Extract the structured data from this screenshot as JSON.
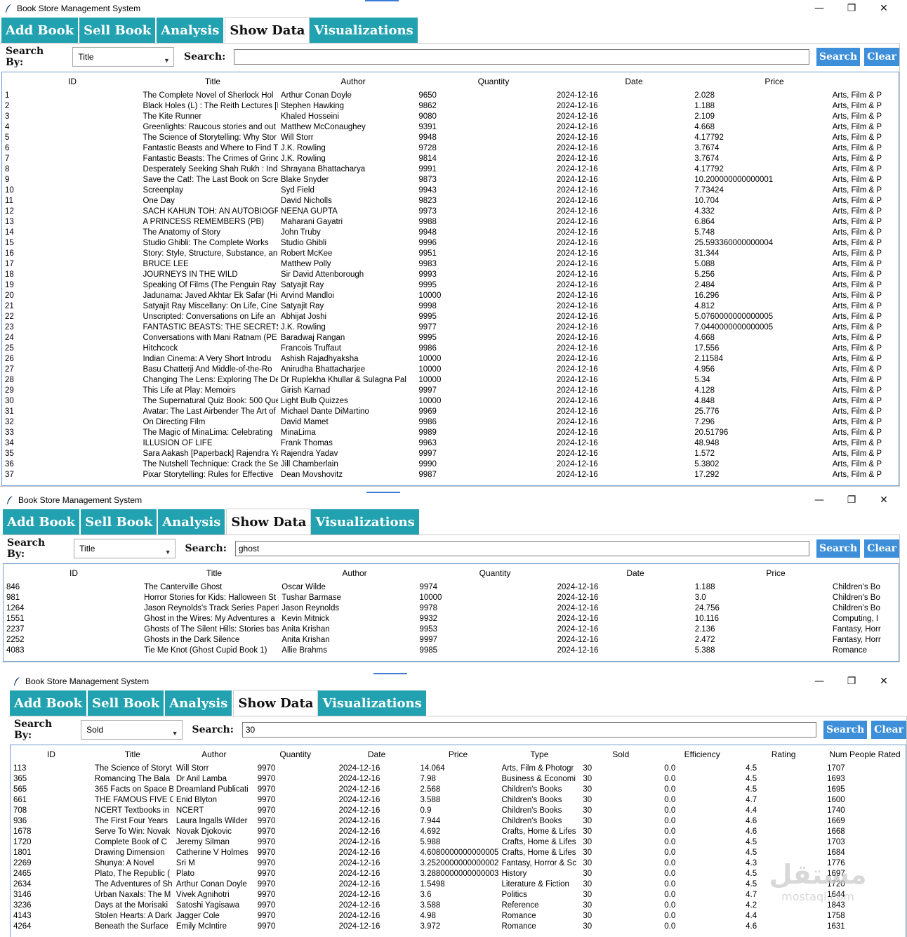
{
  "windows": [
    {
      "app_title": "Book Store Management System",
      "tabs": [
        {
          "label": "Add Book",
          "active": false
        },
        {
          "label": "Sell Book",
          "active": false
        },
        {
          "label": "Analysis",
          "active": false
        },
        {
          "label": "Show Data",
          "active": true
        },
        {
          "label": "Visualizations",
          "active": false
        }
      ],
      "search_by_label": "Search By:",
      "search_by_value": "Title",
      "search_label": "Search:",
      "search_value": "",
      "search_button": "Search",
      "clear_button": "Clear",
      "columns": [
        "ID",
        "Title",
        "Author",
        "Quantity",
        "Date",
        "Price"
      ],
      "rows": [
        [
          "1",
          "The Complete Novel of Sherlock Hol",
          "Arthur Conan Doyle",
          "9650",
          "2024-12-16",
          "2.028",
          "Arts, Film & P"
        ],
        [
          "2",
          "Black Holes (L) : The Reith Lectures [I",
          "Stephen Hawking",
          "9862",
          "2024-12-16",
          "1.188",
          "Arts, Film & P"
        ],
        [
          "3",
          "The Kite Runner",
          "Khaled Hosseini",
          "9080",
          "2024-12-16",
          "2.109",
          "Arts, Film & P"
        ],
        [
          "4",
          "Greenlights: Raucous stories and out",
          "Matthew McConaughey",
          "9391",
          "2024-12-16",
          "4.668",
          "Arts, Film & P"
        ],
        [
          "5",
          "The Science of Storytelling: Why Stor",
          "Will Storr",
          "9948",
          "2024-12-16",
          "4.17792",
          "Arts, Film & P"
        ],
        [
          "6",
          "Fantastic Beasts and Where to Find T",
          "J.K. Rowling",
          "9728",
          "2024-12-16",
          "3.7674",
          "Arts, Film & P"
        ],
        [
          "7",
          "Fantastic Beasts: The Crimes of Grinc",
          "J.K. Rowling",
          "9814",
          "2024-12-16",
          "3.7674",
          "Arts, Film & P"
        ],
        [
          "8",
          "Desperately Seeking Shah Rukh : Indi",
          "Shrayana Bhattacharya",
          "9991",
          "2024-12-16",
          "4.17792",
          "Arts, Film & P"
        ],
        [
          "9",
          "Save the Cat!: The Last Book on Scree",
          "Blake Snyder",
          "9873",
          "2024-12-16",
          "10.200000000000001",
          "Arts, Film & P"
        ],
        [
          "10",
          "Screenplay",
          "Syd Field",
          "9943",
          "2024-12-16",
          "7.73424",
          "Arts, Film & P"
        ],
        [
          "11",
          "One Day",
          "David Nicholls",
          "9823",
          "2024-12-16",
          "10.704",
          "Arts, Film & P"
        ],
        [
          "12",
          "SACH KAHUN TOH: AN AUTOBIOGR",
          "NEENA GUPTA",
          "9973",
          "2024-12-16",
          "4.332",
          "Arts, Film & P"
        ],
        [
          "13",
          "A PRINCESS REMEMBERS (PB)",
          "Maharani Gayatri",
          "9988",
          "2024-12-16",
          "6.864",
          "Arts, Film & P"
        ],
        [
          "14",
          "The Anatomy of Story",
          "John Truby",
          "9948",
          "2024-12-16",
          "5.748",
          "Arts, Film & P"
        ],
        [
          "15",
          "Studio Ghibli: The Complete Works",
          "Studio Ghibli",
          "9996",
          "2024-12-16",
          "25.593360000000004",
          "Arts, Film & P"
        ],
        [
          "16",
          "Story: Style, Structure, Substance, an",
          "Robert McKee",
          "9951",
          "2024-12-16",
          "31.344",
          "Arts, Film & P"
        ],
        [
          "17",
          "BRUCE LEE",
          "Matthew Polly",
          "9983",
          "2024-12-16",
          "5.088",
          "Arts, Film & P"
        ],
        [
          "18",
          "JOURNEYS IN THE WILD",
          "Sir David Attenborough",
          "9993",
          "2024-12-16",
          "5.256",
          "Arts, Film & P"
        ],
        [
          "19",
          "Speaking Of Films (The Penguin Ray",
          "Satyajit Ray",
          "9995",
          "2024-12-16",
          "2.484",
          "Arts, Film & P"
        ],
        [
          "20",
          "Jadunama: Javed Akhtar Ek Safar (Hi",
          "Arvind Mandloi",
          "10000",
          "2024-12-16",
          "16.296",
          "Arts, Film & P"
        ],
        [
          "21",
          "Satyajit Ray Miscellany: On Life, Cine",
          "Satyajit Ray",
          "9998",
          "2024-12-16",
          "4.812",
          "Arts, Film & P"
        ],
        [
          "22",
          "Unscripted: Conversations on Life an",
          "Abhijat Joshi",
          "9995",
          "2024-12-16",
          "5.0760000000000005",
          "Arts, Film & P"
        ],
        [
          "23",
          "FANTASTIC BEASTS: THE SECRETS OI",
          "J.K. Rowling",
          "9977",
          "2024-12-16",
          "7.0440000000000005",
          "Arts, Film & P"
        ],
        [
          "24",
          "Conversations with Mani Ratnam (PE",
          "Baradwaj Rangan",
          "9995",
          "2024-12-16",
          "4.668",
          "Arts, Film & P"
        ],
        [
          "25",
          "Hitchcock",
          "Francois Truffaut",
          "9986",
          "2024-12-16",
          "17.556",
          "Arts, Film & P"
        ],
        [
          "26",
          "Indian Cinema: A Very Short Introdu",
          "Ashish Rajadhyaksha",
          "10000",
          "2024-12-16",
          "2.11584",
          "Arts, Film & P"
        ],
        [
          "27",
          "Basu Chatterji And Middle-of-the-Ro",
          "Anirudha Bhattacharjee",
          "10000",
          "2024-12-16",
          "4.956",
          "Arts, Film & P"
        ],
        [
          "28",
          "Changing The Lens: Exploring The De",
          "Dr Ruplekha Khullar & Sulagna Pal",
          "10000",
          "2024-12-16",
          "5.34",
          "Arts, Film & P"
        ],
        [
          "29",
          "This Life at Play: Memoirs",
          "Girish Karnad",
          "9997",
          "2024-12-16",
          "4.128",
          "Arts, Film & P"
        ],
        [
          "30",
          "The Supernatural Quiz Book: 500 Que",
          "Light Bulb Quizzes",
          "10000",
          "2024-12-16",
          "4.848",
          "Arts, Film & P"
        ],
        [
          "31",
          "Avatar: The Last Airbender The Art of",
          "Michael Dante DiMartino",
          "9969",
          "2024-12-16",
          "25.776",
          "Arts, Film & P"
        ],
        [
          "32",
          "On Directing Film",
          "David Mamet",
          "9986",
          "2024-12-16",
          "7.296",
          "Arts, Film & P"
        ],
        [
          "33",
          "The Magic of MinaLima: Celebrating",
          "MinaLima",
          "9989",
          "2024-12-16",
          "20.51796",
          "Arts, Film & P"
        ],
        [
          "34",
          "ILLUSION OF LIFE",
          "Frank Thomas",
          "9963",
          "2024-12-16",
          "48.948",
          "Arts, Film & P"
        ],
        [
          "35",
          "Sara Aakash [Paperback] Rajendra Ya",
          "Rajendra Yadav",
          "9997",
          "2024-12-16",
          "1.572",
          "Arts, Film & P"
        ],
        [
          "36",
          "The Nutshell Technique: Crack the Se",
          "Jill Chamberlain",
          "9990",
          "2024-12-16",
          "5.3802",
          "Arts, Film & P"
        ],
        [
          "37",
          "Pixar Storytelling: Rules for Effective",
          "Dean Movshovitz",
          "9987",
          "2024-12-16",
          "17.292",
          "Arts, Film & P"
        ]
      ]
    },
    {
      "app_title": "Book Store Management System",
      "tabs": [
        {
          "label": "Add Book",
          "active": false
        },
        {
          "label": "Sell Book",
          "active": false
        },
        {
          "label": "Analysis",
          "active": false
        },
        {
          "label": "Show Data",
          "active": true
        },
        {
          "label": "Visualizations",
          "active": false
        }
      ],
      "search_by_label": "Search By:",
      "search_by_value": "Title",
      "search_label": "Search:",
      "search_value": "ghost",
      "search_button": "Search",
      "clear_button": "Clear",
      "columns": [
        "ID",
        "Title",
        "Author",
        "Quantity",
        "Date",
        "Price"
      ],
      "rows": [
        [
          "846",
          "The Canterville Ghost",
          "Oscar Wilde",
          "9974",
          "2024-12-16",
          "1.188",
          "Children's Bo"
        ],
        [
          "981",
          "Horror Stories for Kids: Halloween St",
          "Tushar Barmase",
          "10000",
          "2024-12-16",
          "3.0",
          "Children's Bo"
        ],
        [
          "1264",
          "Jason Reynolds's Track Series Paperb",
          "Jason Reynolds",
          "9978",
          "2024-12-16",
          "24.756",
          "Children's Bo"
        ],
        [
          "1551",
          "Ghost in the Wires: My Adventures a",
          "Kevin Mitnick",
          "9932",
          "2024-12-16",
          "10.116",
          "Computing, I"
        ],
        [
          "2237",
          "Ghosts of The Silent Hills: Stories bas",
          "Anita Krishan",
          "9953",
          "2024-12-16",
          "2.136",
          "Fantasy, Horr"
        ],
        [
          "2252",
          "Ghosts in the Dark Silence",
          "Anita Krishan",
          "9997",
          "2024-12-16",
          "2.472",
          "Fantasy, Horr"
        ],
        [
          "4083",
          "Tie Me Knot (Ghost Cupid Book 1)",
          "Allie Brahms",
          "9985",
          "2024-12-16",
          "5.388",
          "Romance"
        ]
      ]
    },
    {
      "app_title": "Book Store Management System",
      "tabs": [
        {
          "label": "Add Book",
          "active": false
        },
        {
          "label": "Sell Book",
          "active": false
        },
        {
          "label": "Analysis",
          "active": false
        },
        {
          "label": "Show Data",
          "active": true
        },
        {
          "label": "Visualizations",
          "active": false
        }
      ],
      "search_by_label": "Search By:",
      "search_by_value": "Sold",
      "search_label": "Search:",
      "search_value": "30",
      "search_button": "Search",
      "clear_button": "Clear",
      "columns": [
        "ID",
        "Title",
        "Author",
        "Quantity",
        "Date",
        "Price",
        "Type",
        "Sold",
        "Efficiency",
        "Rating",
        "Num People Rated"
      ],
      "rows": [
        [
          "113",
          "The Science of Storyt",
          "Will Storr",
          "9970",
          "2024-12-16",
          "14.064",
          "Arts, Film & Photogr",
          "30",
          "0.0",
          "4.5",
          "1707"
        ],
        [
          "365",
          "Romancing The Bala",
          "Dr Anil Lamba",
          "9970",
          "2024-12-16",
          "7.98",
          "Business & Economi",
          "30",
          "0.0",
          "4.5",
          "1693"
        ],
        [
          "565",
          "365 Facts on Space B",
          "Dreamland Publicati",
          "9970",
          "2024-12-16",
          "2.568",
          "Children's Books",
          "30",
          "0.0",
          "4.5",
          "1695"
        ],
        [
          "661",
          "THE FAMOUS FIVE C",
          "Enid Blyton",
          "9970",
          "2024-12-16",
          "3.588",
          "Children's Books",
          "30",
          "0.0",
          "4.7",
          "1600"
        ],
        [
          "708",
          "NCERT Textbooks in",
          "NCERT",
          "9970",
          "2024-12-16",
          "0.9",
          "Children's Books",
          "30",
          "0.0",
          "4.4",
          "1740"
        ],
        [
          "936",
          "The First Four Years",
          "Laura Ingalls Wilder",
          "9970",
          "2024-12-16",
          "7.944",
          "Children's Books",
          "30",
          "0.0",
          "4.6",
          "1669"
        ],
        [
          "1678",
          "Serve To Win: Novak",
          "Novak Djokovic",
          "9970",
          "2024-12-16",
          "4.692",
          "Crafts, Home & Lifes",
          "30",
          "0.0",
          "4.6",
          "1668"
        ],
        [
          "1720",
          "Complete Book of C",
          "Jeremy Silman",
          "9970",
          "2024-12-16",
          "5.988",
          "Crafts, Home & Lifes",
          "30",
          "0.0",
          "4.5",
          "1703"
        ],
        [
          "1801",
          "Drawing Dimension",
          "Catherine V Holmes",
          "9970",
          "2024-12-16",
          "4.6080000000000005",
          "Crafts, Home & Lifes",
          "30",
          "0.0",
          "4.5",
          "1684"
        ],
        [
          "2269",
          "Shunya: A Novel",
          "Sri M",
          "9970",
          "2024-12-16",
          "3.2520000000000002",
          "Fantasy, Horror & Sc",
          "30",
          "0.0",
          "4.3",
          "1776"
        ],
        [
          "2465",
          "Plato, The Republic (",
          "Plato",
          "9970",
          "2024-12-16",
          "3.2880000000000003",
          "History",
          "30",
          "0.0",
          "4.5",
          "1697"
        ],
        [
          "2634",
          "The Adventures of Sh",
          "Arthur Conan Doyle",
          "9970",
          "2024-12-16",
          "1.5498",
          "Literature & Fiction",
          "30",
          "0.0",
          "4.5",
          "1720"
        ],
        [
          "3146",
          "Urban Naxals: The M",
          "Vivek Agnihotri",
          "9970",
          "2024-12-16",
          "3.6",
          "Politics",
          "30",
          "0.0",
          "4.7",
          "1644"
        ],
        [
          "3236",
          "Days at the Morisaki",
          "Satoshi Yagisawa",
          "9970",
          "2024-12-16",
          "3.588",
          "Reference",
          "30",
          "0.0",
          "4.2",
          "1843"
        ],
        [
          "4143",
          "Stolen Hearts: A Dark",
          "Jagger Cole",
          "9970",
          "2024-12-16",
          "4.98",
          "Romance",
          "30",
          "0.0",
          "4.4",
          "1758"
        ],
        [
          "4264",
          "Beneath the Surface",
          "Emily McIntire",
          "9970",
          "2024-12-16",
          "3.972",
          "Romance",
          "30",
          "0.0",
          "4.6",
          "1631"
        ]
      ],
      "watermark": {
        "brand": "مستقل",
        "site": "mostaql.com"
      }
    }
  ],
  "colors": {
    "tab_bg": "#22a2b0",
    "button_bg": "#3d8fd9",
    "tree_border": "#6e9bd0"
  }
}
